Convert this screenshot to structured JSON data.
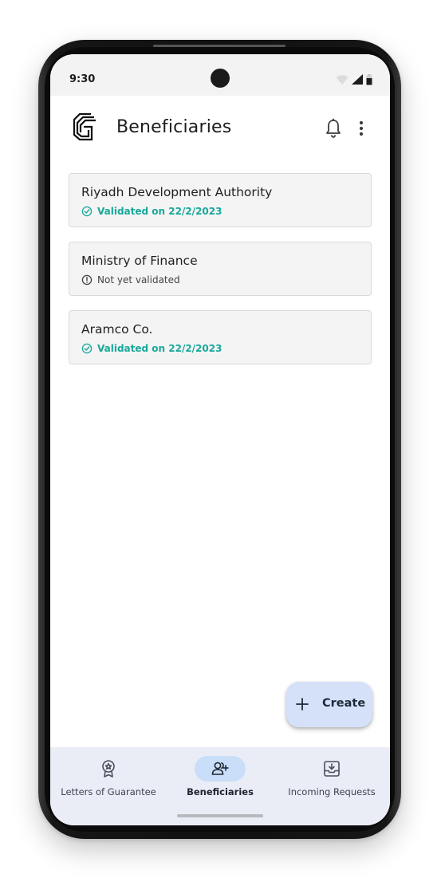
{
  "status_bar": {
    "time": "9:30"
  },
  "app_bar": {
    "title": "Beneficiaries",
    "logo_icon": "company-logo-icon",
    "actions": [
      "bell-icon",
      "more-vert-icon"
    ]
  },
  "beneficiaries": [
    {
      "name": "Riyadh Development Authority",
      "status": "Validated on 22/2/2023",
      "validated": true,
      "status_icon": "check-circle-icon"
    },
    {
      "name": "Ministry of Finance",
      "status": "Not yet validated",
      "validated": false,
      "status_icon": "info-circle-icon"
    },
    {
      "name": "Aramco Co.",
      "status": "Validated on 22/2/2023",
      "validated": true,
      "status_icon": "check-circle-icon"
    }
  ],
  "fab": {
    "label": "Create",
    "icon": "plus-icon"
  },
  "bottom_nav": [
    {
      "label": "Letters of Guarantee",
      "icon": "award-badge-icon",
      "active": false
    },
    {
      "label": "Beneficiaries",
      "icon": "add-user-icon",
      "active": true
    },
    {
      "label": "Incoming Requests",
      "icon": "inbox-download-icon",
      "active": false
    }
  ],
  "colors": {
    "validated": "#17a89a",
    "fab_background": "#d5e1f8",
    "nav_background": "#eaedf6",
    "nav_active_pill": "#c9def8",
    "card_background": "#f4f4f4"
  }
}
